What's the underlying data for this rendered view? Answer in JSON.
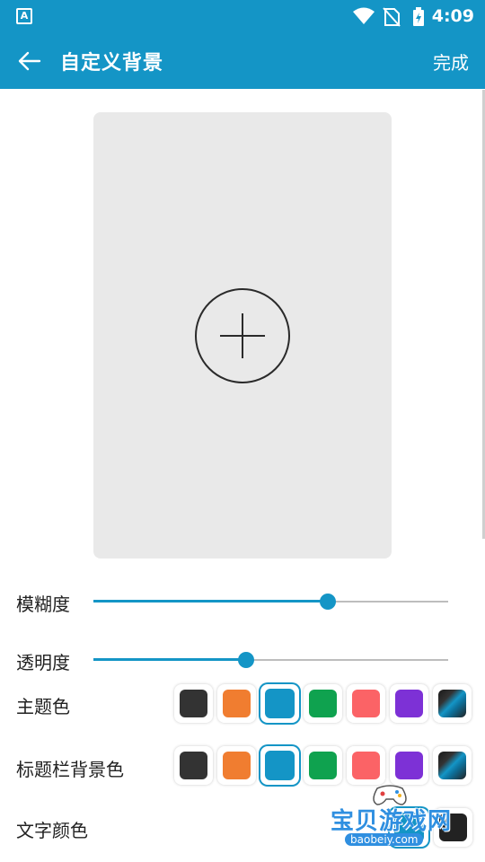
{
  "status_bar": {
    "time": "4:09",
    "icons": [
      "app-notification-icon",
      "wifi-icon",
      "no-sim-icon",
      "battery-charging-icon"
    ]
  },
  "app_bar": {
    "back_icon": "arrow-left-icon",
    "title": "自定义背景",
    "done_label": "完成",
    "background_color": "#1495c6"
  },
  "preview": {
    "add_icon": "circle-plus-icon"
  },
  "blur": {
    "label": "模糊度",
    "value_fraction": 0.66
  },
  "opacity": {
    "label": "透明度",
    "value_fraction": 0.43
  },
  "theme_color": {
    "label": "主题色",
    "selected_index": 2,
    "options": [
      "#333333",
      "#f07d30",
      "#1495c6",
      "#0fa24f",
      "#fb6366",
      "#7d31d6",
      "gradient-dark-blue"
    ]
  },
  "titlebar_color": {
    "label": "标题栏背景色",
    "selected_index": 2,
    "options": [
      "#333333",
      "#f07d30",
      "#1495c6",
      "#0fa24f",
      "#fb6366",
      "#7d31d6",
      "gradient-dark-blue"
    ]
  },
  "text_color": {
    "label": "文字颜色"
  },
  "watermark": {
    "text": "宝贝游戏网",
    "url": "baobeiy.com"
  }
}
